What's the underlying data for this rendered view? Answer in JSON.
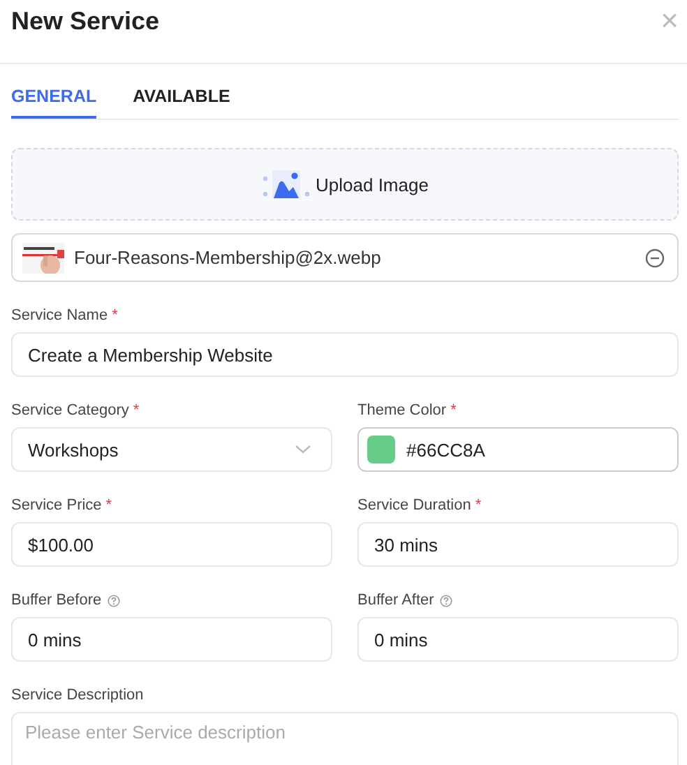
{
  "dialog": {
    "title": "New Service",
    "close": "×"
  },
  "tabs": [
    {
      "label": "GENERAL",
      "selected": true
    },
    {
      "label": "AVAILABLE",
      "selected": false
    }
  ],
  "upload": {
    "label": "Upload Image"
  },
  "file": {
    "name": "Four-Reasons-Membership@2x.webp"
  },
  "rows": [
    [
      {
        "label": "Service Name",
        "required_mark": "*",
        "help": false,
        "kind": "text",
        "value": "Create a Membership Website"
      }
    ],
    [
      {
        "label": "Service Category",
        "required_mark": "*",
        "help": false,
        "kind": "select",
        "value": "Workshops"
      },
      {
        "label": "Theme Color",
        "required_mark": "*",
        "help": false,
        "kind": "color",
        "value": "#66CC8A",
        "color": "#66cc8a"
      }
    ],
    [
      {
        "label": "Service Price",
        "required_mark": "*",
        "help": false,
        "kind": "text",
        "value": "$100.00"
      },
      {
        "label": "Service Duration",
        "required_mark": "*",
        "help": false,
        "kind": "text",
        "value": "30 mins"
      }
    ],
    [
      {
        "label": "Buffer Before",
        "help": true,
        "kind": "text",
        "value": "0 mins"
      },
      {
        "label": "Buffer After",
        "help": true,
        "kind": "text",
        "value": "0 mins"
      }
    ],
    [
      {
        "label": "Service Description",
        "help": false,
        "kind": "textarea",
        "placeholder": "Please enter Service description"
      }
    ]
  ]
}
